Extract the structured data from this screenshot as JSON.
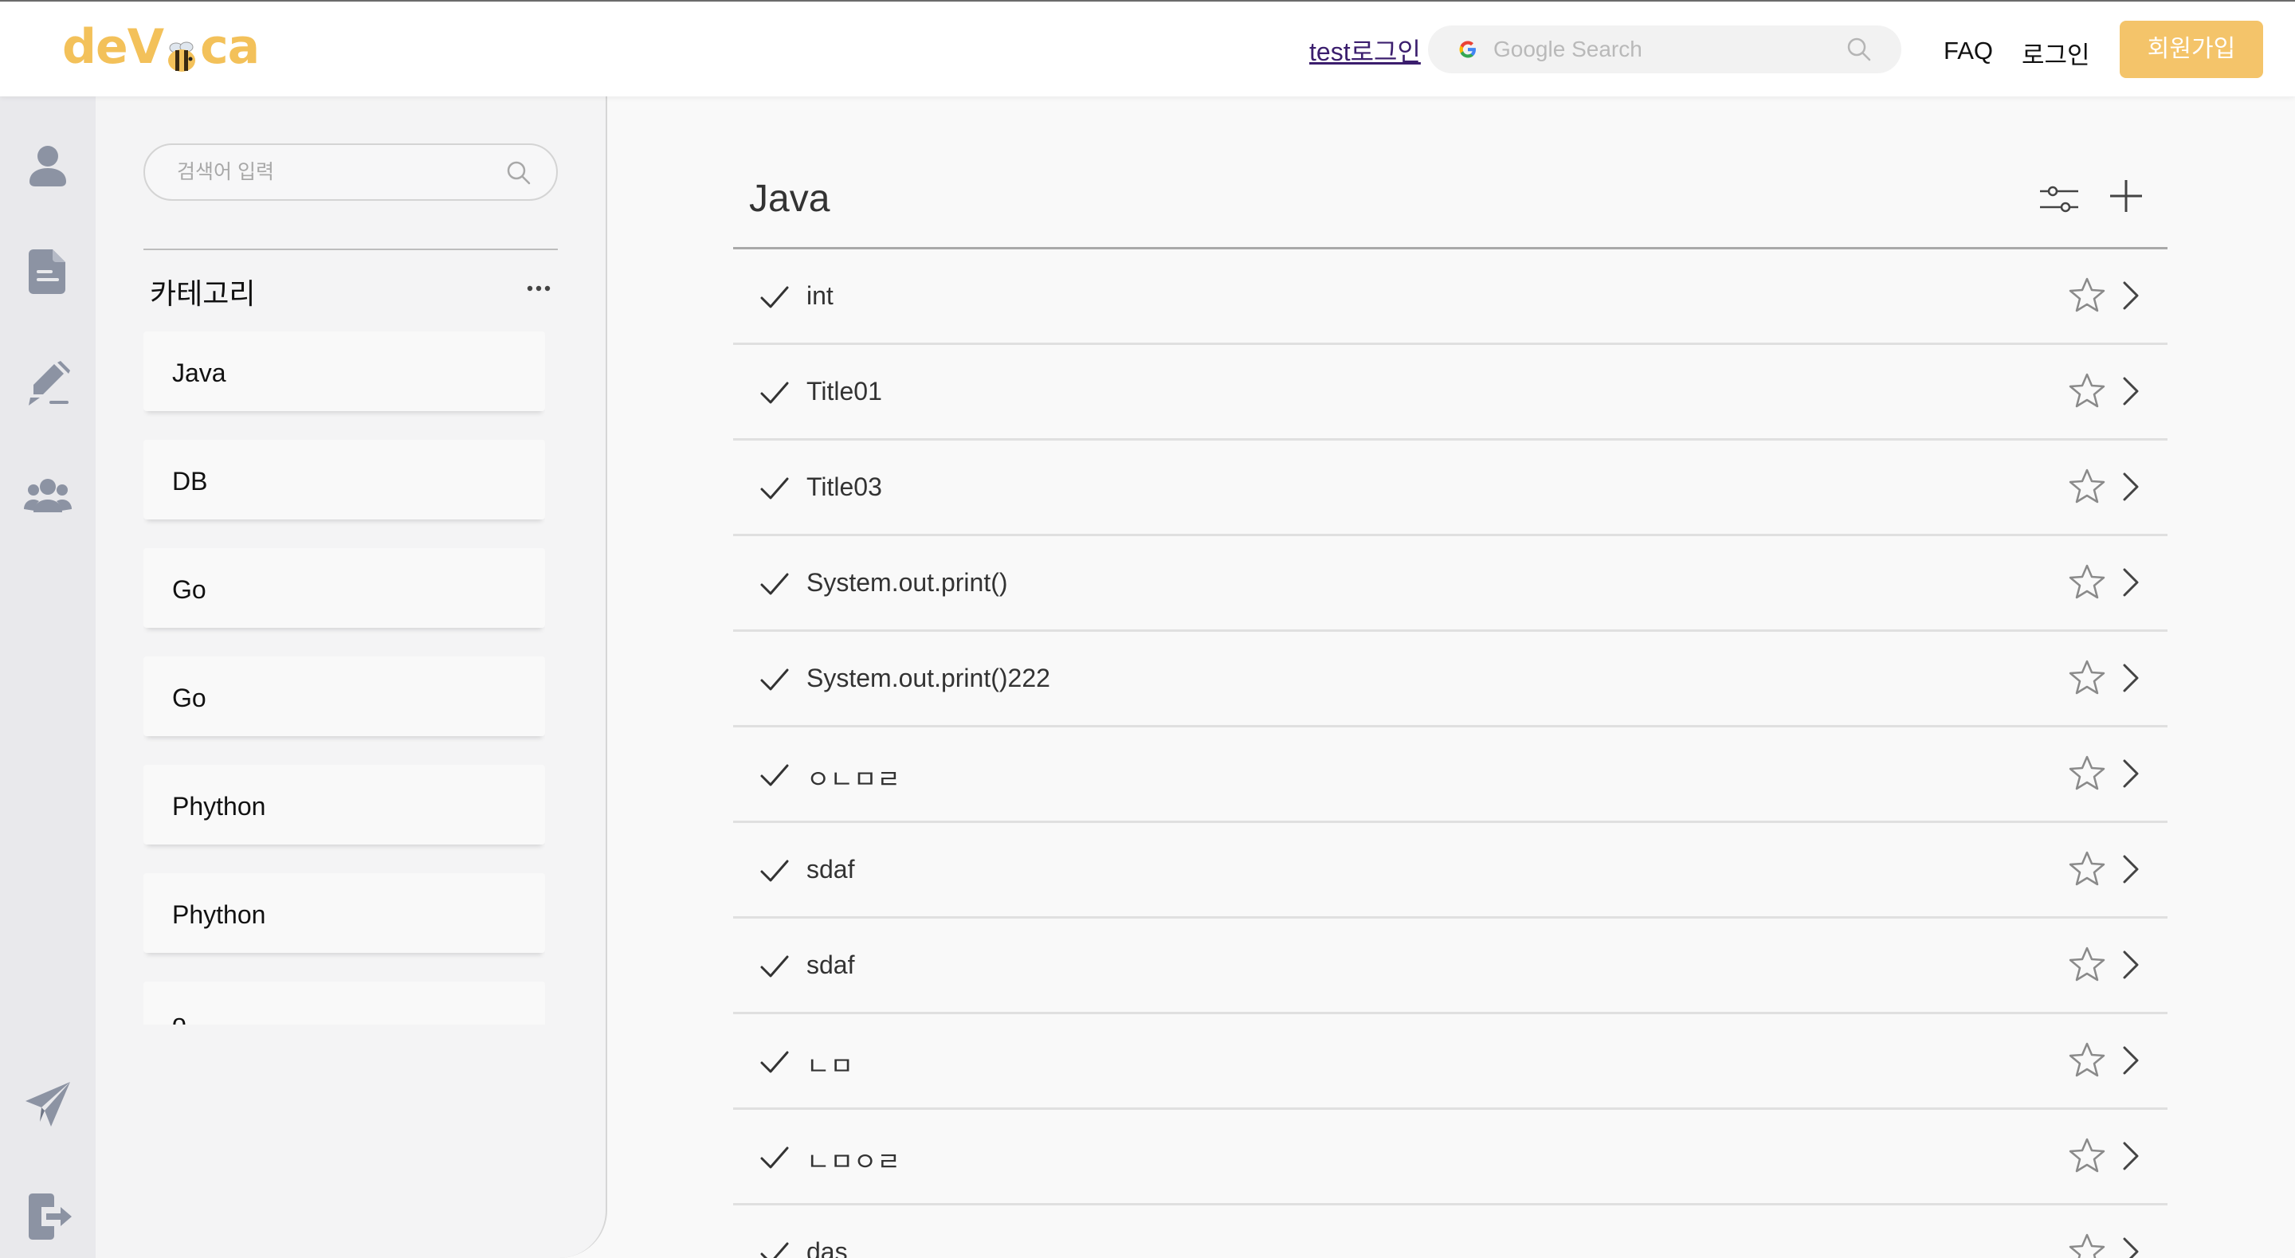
{
  "header": {
    "logo_text_left": "deV",
    "logo_text_right": "ca",
    "test_login": "test로그인",
    "google_search_placeholder": "Google Search",
    "nav_faq": "FAQ",
    "nav_login": "로그인",
    "signup": "회원가입"
  },
  "rail": {
    "items": [
      "user-icon",
      "document-icon",
      "edit-icon",
      "group-icon",
      "send-icon",
      "logout-icon"
    ]
  },
  "categories": {
    "search_placeholder": "검색어 입력",
    "title": "카테고리",
    "items": [
      "Java",
      "DB",
      "Go",
      "Go",
      "Phython",
      "Phython",
      "o"
    ]
  },
  "main": {
    "title": "Java",
    "words": [
      "int",
      "Title01",
      "Title03",
      "System.out.print()",
      "System.out.print()222",
      "ㅇㄴㅁㄹ",
      "sdaf",
      "sdaf",
      "ㄴㅁ",
      "ㄴㅁㅇㄹ",
      "das"
    ]
  },
  "colors": {
    "brand": "#f3c15a",
    "signup_bg": "#f4c46a",
    "rail_bg": "#e9e9ec",
    "icon_gray": "#8c93a3"
  }
}
